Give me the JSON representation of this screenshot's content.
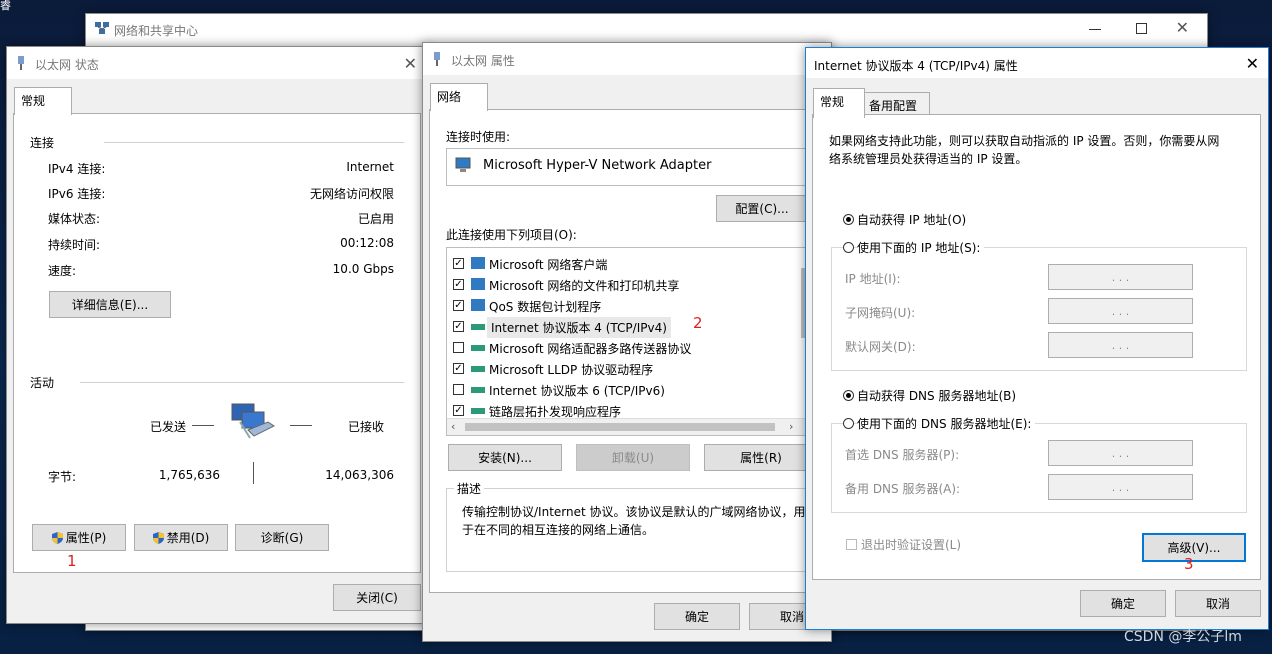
{
  "desktop": {
    "corner_text": "睿"
  },
  "bg_window": {
    "title": "网络和共享中心"
  },
  "status_window": {
    "title": "以太网 状态",
    "tab": "常规",
    "connection_group": "连接",
    "rows": [
      {
        "label": "IPv4 连接:",
        "value": "Internet"
      },
      {
        "label": "IPv6 连接:",
        "value": "无网络访问权限"
      },
      {
        "label": "媒体状态:",
        "value": "已启用"
      },
      {
        "label": "持续时间:",
        "value": "00:12:08"
      },
      {
        "label": "速度:",
        "value": "10.0 Gbps"
      }
    ],
    "details_button": "详细信息(E)...",
    "activity_group": "活动",
    "sent_label": "已发送",
    "received_label": "已接收",
    "bytes_label": "字节:",
    "bytes_sent": "1,765,636",
    "bytes_received": "14,063,306",
    "properties_button": "属性(P)",
    "disable_button": "禁用(D)",
    "diagnose_button": "诊断(G)",
    "close_button": "关闭(C)",
    "annotation": "1"
  },
  "props_window": {
    "title": "以太网 属性",
    "tab": "网络",
    "connect_using_label": "连接时使用:",
    "adapter": "Microsoft Hyper-V Network Adapter",
    "configure_button": "配置(C)...",
    "items_label": "此连接使用下列项目(O):",
    "items": [
      {
        "label": "Microsoft 网络客户端",
        "checked": true
      },
      {
        "label": "Microsoft 网络的文件和打印机共享",
        "checked": true
      },
      {
        "label": "QoS 数据包计划程序",
        "checked": true
      },
      {
        "label": "Internet 协议版本 4 (TCP/IPv4)",
        "checked": true
      },
      {
        "label": "Microsoft 网络适配器多路传送器协议",
        "checked": false
      },
      {
        "label": "Microsoft LLDP 协议驱动程序",
        "checked": true
      },
      {
        "label": "Internet 协议版本 6 (TCP/IPv6)",
        "checked": false
      },
      {
        "label": "链路层拓扑发现响应程序",
        "checked": true
      }
    ],
    "install_button": "安装(N)...",
    "uninstall_button": "卸载(U)",
    "properties_button": "属性(R)",
    "description_group": "描述",
    "description_line1": "传输控制协议/Internet 协议。该协议是默认的广域网络协议，用",
    "description_line2": "于在不同的相互连接的网络上通信。",
    "ok_button": "确定",
    "cancel_button": "取消",
    "annotation": "2"
  },
  "ipv4_window": {
    "title": "Internet 协议版本 4 (TCP/IPv4) 属性",
    "tab_general": "常规",
    "tab_alternate": "备用配置",
    "intro_line1": "如果网络支持此功能，则可以获取自动指派的 IP 设置。否则，你需要从网",
    "intro_line2": "络系统管理员处获得适当的 IP 设置。",
    "auto_ip": "自动获得 IP 地址(O)",
    "manual_ip": "使用下面的 IP 地址(S):",
    "ip_label": "IP 地址(I):",
    "mask_label": "子网掩码(U):",
    "gateway_label": "默认网关(D):",
    "auto_dns": "自动获得 DNS 服务器地址(B)",
    "manual_dns": "使用下面的 DNS 服务器地址(E):",
    "dns1_label": "首选 DNS 服务器(P):",
    "dns2_label": "备用 DNS 服务器(A):",
    "ip_placeholder": ".   .   .",
    "validate_label": "退出时验证设置(L)",
    "advanced_button": "高级(V)...",
    "ok_button": "确定",
    "cancel_button": "取消",
    "annotation": "3"
  },
  "watermark": "CSDN @李公子lm"
}
